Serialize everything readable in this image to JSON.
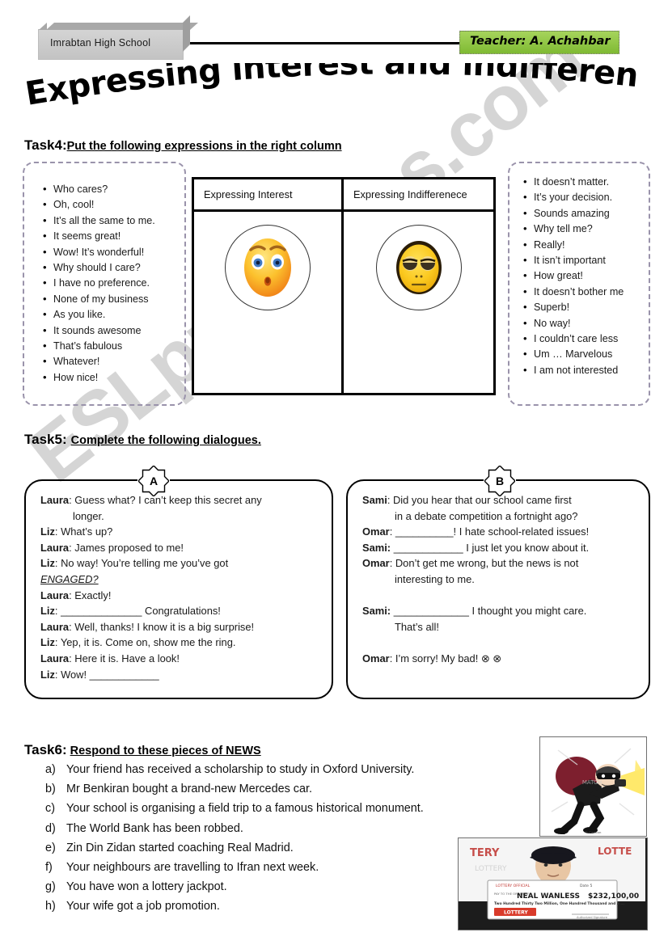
{
  "header": {
    "school_name": "Imrabtan High School",
    "teacher_label": "Teacher:  A. Achahbar",
    "title": "Expressing interest and indifference"
  },
  "watermark": {
    "text": "ESLprintables.com"
  },
  "task4": {
    "number": "Task4:",
    "instruction": "Put the following expressions in the right column",
    "left_expressions": [
      "Who cares?",
      "Oh, cool!",
      "It’s all the same to me.",
      "It seems great!",
      "Wow! It’s wonderful!",
      "Why should I care?",
      "I have no preference.",
      "None of my business",
      "As you like.",
      "It sounds awesome",
      "That’s fabulous",
      "Whatever!",
      "How nice!"
    ],
    "right_expressions": [
      "It doesn’t matter.",
      "It’s your decision.",
      "Sounds amazing",
      "Why tell me?",
      "Really!",
      "It isn’t important",
      "How great!",
      "It doesn’t bother me",
      "Superb!",
      "No way!",
      "I couldn’t care less",
      "Um … Marvelous",
      "I am not interested"
    ],
    "column_headers": [
      "Expressing Interest",
      "Expressing Indifferenece"
    ],
    "icons": [
      "surprised-face-emoji",
      "bored-face-emoji"
    ]
  },
  "task5": {
    "number": "Task5",
    "separator": ":",
    "instruction": "Complete the following dialogues.",
    "dialogue_a": {
      "badge": "A",
      "lines": [
        {
          "speaker": "Laura",
          "text": ": Guess what? I can’t keep this secret any"
        },
        {
          "speaker": "",
          "text": "longer.",
          "indent": true
        },
        {
          "speaker": "Liz",
          "text": ": What’s up?"
        },
        {
          "speaker": "Laura",
          "text": ": James proposed to me!"
        },
        {
          "speaker": "Liz",
          "text": ": No way! You’re telling me you’ve got"
        },
        {
          "speaker": "",
          "text": "ENGAGED?",
          "emph": true
        },
        {
          "speaker": "Laura",
          "text": ": Exactly!"
        },
        {
          "speaker": "Liz",
          "text": ":  ______________  Congratulations!"
        },
        {
          "speaker": "Laura",
          "text": ": Well, thanks! I know it is a big surprise!"
        },
        {
          "speaker": "Liz",
          "text": ": Yep, it is. Come on, show me the ring."
        },
        {
          "speaker": "Laura",
          "text": ": Here it is. Have a look!"
        },
        {
          "speaker": "Liz",
          "text": ": Wow! ____________"
        }
      ]
    },
    "dialogue_b": {
      "badge": "B",
      "lines": [
        {
          "speaker": "Sami",
          "text": ": Did you hear that our school came first"
        },
        {
          "speaker": "",
          "text": "in a debate competition a fortnight ago?",
          "indent": true
        },
        {
          "speaker": "Omar",
          "text": ": __________! I hate school-related issues!"
        },
        {
          "speaker": "Sami:",
          "text": " ____________ I just let you know about it."
        },
        {
          "speaker": "Omar",
          "text": ": Don’t get me wrong, but the news is not"
        },
        {
          "speaker": "",
          "text": "interesting to me.",
          "indent": true
        },
        {
          "speaker": "",
          "text": "",
          "spacer": true
        },
        {
          "speaker": "Sami:",
          "text": " _____________ I thought you might care."
        },
        {
          "speaker": "",
          "text": "That’s all!",
          "indent": true
        },
        {
          "speaker": "",
          "text": "",
          "spacer": true
        },
        {
          "speaker": "Omar",
          "text": ": I’m sorry! My bad! ⊗ ⊗"
        }
      ]
    }
  },
  "task6": {
    "number": "Task6:",
    "instruction": "Respond to these pieces of NEWS",
    "items": [
      {
        "label": "a)",
        "text": "Your friend has received a scholarship to study in Oxford University."
      },
      {
        "label": "b)",
        "text": "Mr Benkiran bought a brand-new Mercedes car."
      },
      {
        "label": "c)",
        "text": "Your school is organising a field trip  to a famous historical monument."
      },
      {
        "label": "d)",
        "text": "The World Bank has been robbed."
      },
      {
        "label": "e)",
        "text": "Zin Din Zidan started coaching Real Madrid."
      },
      {
        "label": "f)",
        "text": "Your neighbours are travelling to Ifran next week."
      },
      {
        "label": "g)",
        "text": "You have won a lottery jackpot."
      },
      {
        "label": "h)",
        "text": "Your wife got a job promotion."
      }
    ],
    "images": [
      {
        "name": "burglar-cartoon",
        "caption": "© Cartoon"
      },
      {
        "name": "lottery-winner-photo",
        "winner_name": "NEAL WANLESS",
        "amount": "232,100,00",
        "brand": "LOTTERY"
      }
    ]
  },
  "colors": {
    "teacher_badge": "#8ec63f",
    "school_box": "#c3c3c3",
    "dashed_border": "#9a93ab",
    "table_border": "#000000",
    "watermark": "#c8c8c8"
  }
}
